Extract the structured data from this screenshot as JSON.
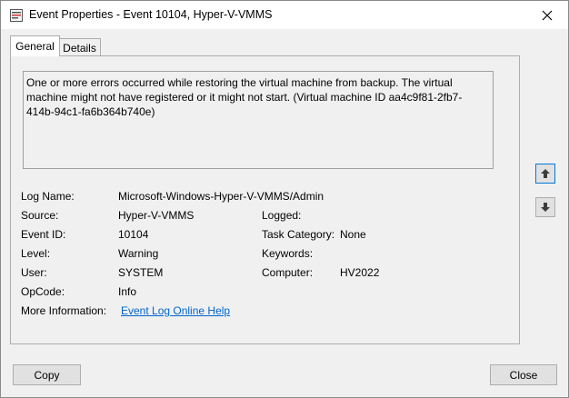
{
  "window": {
    "title": "Event Properties - Event 10104, Hyper-V-VMMS"
  },
  "tabs": [
    {
      "label": "General",
      "selected": true
    },
    {
      "label": "Details",
      "selected": false
    }
  ],
  "description": "One or more errors occurred while restoring the virtual machine from backup. The virtual machine might not have registered or it might not start. (Virtual machine ID aa4c9f81-2fb7-414b-94c1-fa6b364b740e)",
  "fields": {
    "log_name_label": "Log Name:",
    "log_name_value": "Microsoft-Windows-Hyper-V-VMMS/Admin",
    "source_label": "Source:",
    "source_value": "Hyper-V-VMMS",
    "logged_label": "Logged:",
    "logged_value": "",
    "event_id_label": "Event ID:",
    "event_id_value": "10104",
    "task_category_label": "Task Category:",
    "task_category_value": "None",
    "level_label": "Level:",
    "level_value": "Warning",
    "keywords_label": "Keywords:",
    "keywords_value": "",
    "user_label": "User:",
    "user_value": "SYSTEM",
    "computer_label": "Computer:",
    "computer_value": "HV2022",
    "opcode_label": "OpCode:",
    "opcode_value": "Info",
    "more_info_label": "More Information:",
    "more_info_link": "Event Log Online Help"
  },
  "buttons": {
    "copy": "Copy",
    "close": "Close"
  },
  "icons": {
    "app": "event-properties-icon",
    "close": "close-icon",
    "up": "arrow-up-icon",
    "down": "arrow-down-icon"
  },
  "colors": {
    "link": "#0066cc",
    "focus": "#0078d7"
  }
}
